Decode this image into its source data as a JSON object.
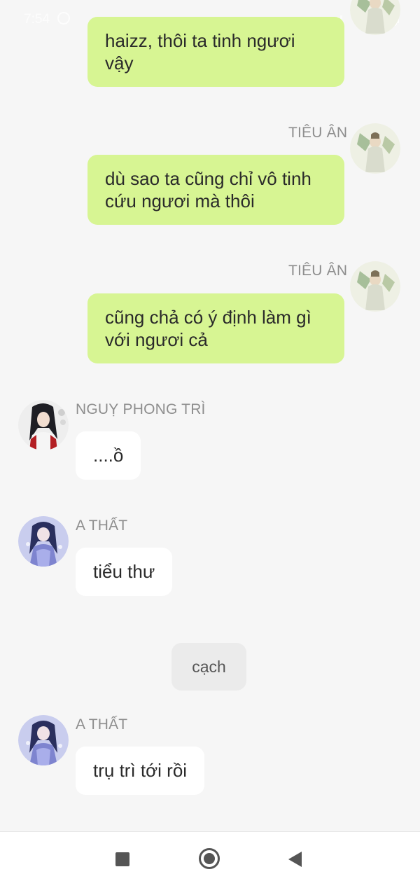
{
  "status_bar": {
    "time": "7:54"
  },
  "messages": [
    {
      "side": "right",
      "sender": "",
      "text_lines": [
        "haizz, thôi ta tinh ngươi",
        "vậy"
      ]
    },
    {
      "side": "right",
      "sender": "TIÊU ÂN",
      "text_lines": [
        "dù sao ta cũng chỉ vô tinh",
        "cứu ngươi mà thôi"
      ]
    },
    {
      "side": "right",
      "sender": "TIÊU ÂN",
      "text_lines": [
        "cũng chả có ý định làm gì",
        "với ngươi cả"
      ]
    },
    {
      "side": "left",
      "sender": "NGUỴ PHONG TRÌ",
      "text": "....ồ"
    },
    {
      "side": "left",
      "sender": "A THẤT",
      "text": "tiểu thư"
    },
    {
      "side": "center",
      "text": "cạch"
    },
    {
      "side": "left",
      "sender": "A THẤT",
      "text": "trụ trì tới rồi"
    }
  ],
  "colors": {
    "background": "#f6f6f6",
    "bubble_right": "#d7f593",
    "bubble_left": "#ffffff",
    "sound_effect": "#ebebeb",
    "sender_name": "#8e8e8e"
  },
  "nav_bar": {
    "icons": [
      "recent-apps-icon",
      "home-icon",
      "back-icon"
    ]
  }
}
